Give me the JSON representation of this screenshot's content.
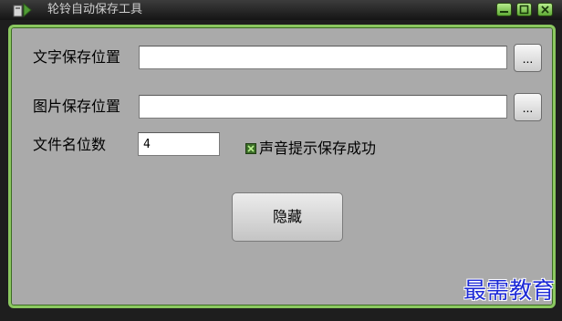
{
  "window": {
    "title": "轮铃自动保存工具",
    "icons": {
      "app": "app-icon",
      "minimize": "minimize-icon",
      "maximize": "maximize-icon",
      "close": "close-icon"
    }
  },
  "form": {
    "text_save_label": "文字保存位置",
    "text_save_value": "",
    "image_save_label": "图片保存位置",
    "image_save_value": "",
    "browse_label": "...",
    "filename_digits_label": "文件名位数",
    "filename_digits_value": "4",
    "sound_checkbox_label": "声音提示保存成功",
    "sound_checkbox_checked": true,
    "hide_button_label": "隐藏"
  },
  "watermark": "最需教育",
  "colors": {
    "frame_border": "#8bc860",
    "panel_background": "#aaaaaa",
    "window_control": "#7bc94a",
    "checkbox": "#3c6f29",
    "watermark": "#1d2ad6"
  }
}
